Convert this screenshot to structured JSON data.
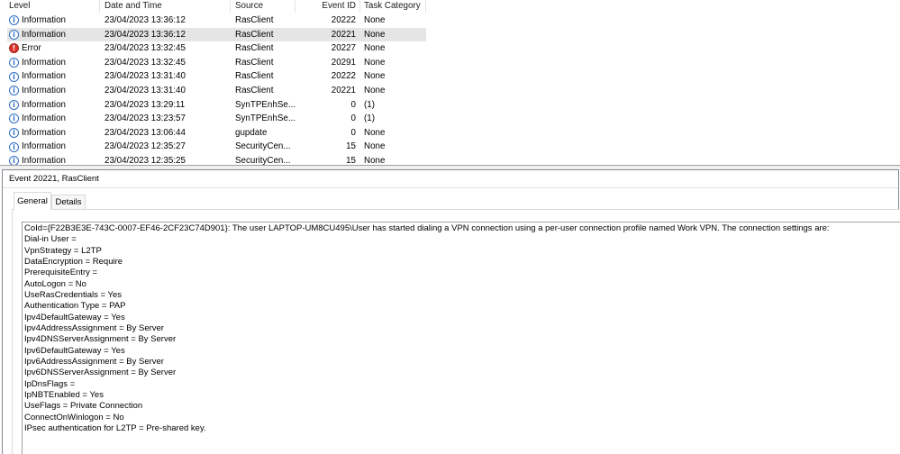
{
  "events_table": {
    "columns": {
      "level": "Level",
      "date_time": "Date and Time",
      "source": "Source",
      "event_id": "Event ID",
      "task_category": "Task Category"
    },
    "rows": [
      {
        "level": "Information",
        "icon": "info-icon",
        "date_time": "23/04/2023 13:36:12",
        "source": "RasClient",
        "event_id": "20222",
        "task_category": "None",
        "selected": false
      },
      {
        "level": "Information",
        "icon": "info-icon",
        "date_time": "23/04/2023 13:36:12",
        "source": "RasClient",
        "event_id": "20221",
        "task_category": "None",
        "selected": true
      },
      {
        "level": "Error",
        "icon": "error-icon",
        "date_time": "23/04/2023 13:32:45",
        "source": "RasClient",
        "event_id": "20227",
        "task_category": "None",
        "selected": false
      },
      {
        "level": "Information",
        "icon": "info-icon",
        "date_time": "23/04/2023 13:32:45",
        "source": "RasClient",
        "event_id": "20291",
        "task_category": "None",
        "selected": false
      },
      {
        "level": "Information",
        "icon": "info-icon",
        "date_time": "23/04/2023 13:31:40",
        "source": "RasClient",
        "event_id": "20222",
        "task_category": "None",
        "selected": false
      },
      {
        "level": "Information",
        "icon": "info-icon",
        "date_time": "23/04/2023 13:31:40",
        "source": "RasClient",
        "event_id": "20221",
        "task_category": "None",
        "selected": false
      },
      {
        "level": "Information",
        "icon": "info-icon",
        "date_time": "23/04/2023 13:29:11",
        "source": "SynTPEnhSe...",
        "event_id": "0",
        "task_category": "(1)",
        "selected": false
      },
      {
        "level": "Information",
        "icon": "info-icon",
        "date_time": "23/04/2023 13:23:57",
        "source": "SynTPEnhSe...",
        "event_id": "0",
        "task_category": "(1)",
        "selected": false
      },
      {
        "level": "Information",
        "icon": "info-icon",
        "date_time": "23/04/2023 13:06:44",
        "source": "gupdate",
        "event_id": "0",
        "task_category": "None",
        "selected": false
      },
      {
        "level": "Information",
        "icon": "info-icon",
        "date_time": "23/04/2023 12:35:27",
        "source": "SecurityCen...",
        "event_id": "15",
        "task_category": "None",
        "selected": false
      },
      {
        "level": "Information",
        "icon": "info-icon",
        "date_time": "23/04/2023 12:35:25",
        "source": "SecurityCen...",
        "event_id": "15",
        "task_category": "None",
        "selected": false
      }
    ]
  },
  "details": {
    "title": "Event 20221, RasClient",
    "tabs": [
      {
        "label": "General",
        "active": true
      },
      {
        "label": "Details",
        "active": false
      }
    ],
    "message_lines": [
      "CoId={F22B3E3E-743C-0007-EF46-2CF23C74D901}: The user LAPTOP-UM8CU495\\User has started dialing a VPN connection using a per-user connection profile named Work VPN. The connection settings are:",
      "Dial-in User = ",
      "VpnStrategy = L2TP",
      "DataEncryption = Require",
      "PrerequisiteEntry = ",
      "AutoLogon = No",
      "UseRasCredentials = Yes",
      "Authentication Type = PAP",
      "Ipv4DefaultGateway = Yes",
      "Ipv4AddressAssignment = By Server",
      "Ipv4DNSServerAssignment = By Server",
      "Ipv6DefaultGateway = Yes",
      "Ipv6AddressAssignment = By Server",
      "Ipv6DNSServerAssignment = By Server",
      "IpDnsFlags = ",
      "IpNBTEnabled = Yes",
      "UseFlags = Private Connection",
      "ConnectOnWinlogon = No",
      "IPsec authentication for L2TP = Pre-shared key."
    ]
  },
  "colors": {
    "selection": "#e5e5e5",
    "info_icon": "#2f6fc5",
    "error_icon": "#d9342b",
    "pane_border": "#828790"
  }
}
